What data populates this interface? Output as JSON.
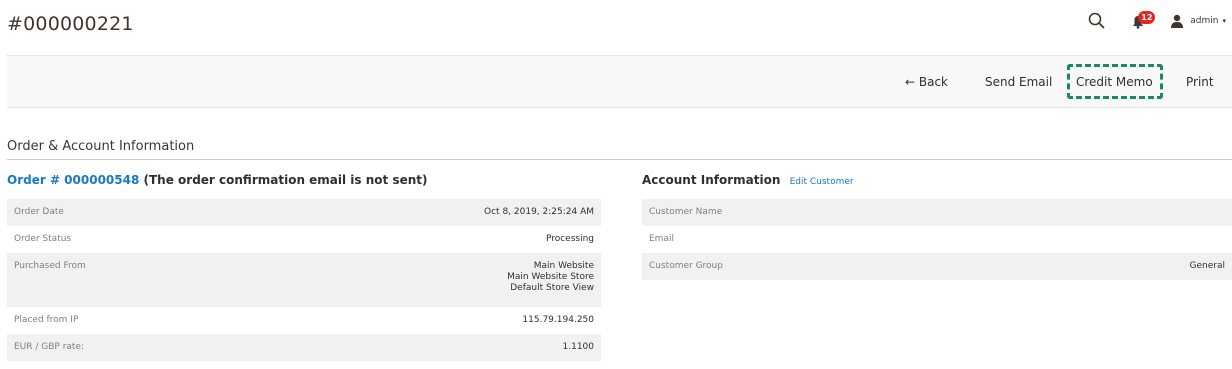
{
  "header": {
    "title": "#000000221",
    "notification_count": "12",
    "user_name": "admin",
    "caret": "▾"
  },
  "toolbar": {
    "back_label": "← Back",
    "send_email_label": "Send Email",
    "credit_memo_label": "Credit Memo",
    "print_label": "Print"
  },
  "section": {
    "title": "Order & Account Information"
  },
  "order": {
    "link_text": "Order # 000000548",
    "note": "(The order confirmation email is not sent)",
    "rows": [
      {
        "label": "Order Date",
        "value": "Oct 8, 2019, 2:25:24 AM"
      },
      {
        "label": "Order Status",
        "value": "Processing"
      },
      {
        "label": "Purchased From",
        "values": [
          "Main Website",
          "Main Website Store",
          "Default Store View"
        ]
      },
      {
        "label": "Placed from IP",
        "value": "115.79.194.250"
      },
      {
        "label": "EUR / GBP rate:",
        "value": "1.1100"
      }
    ]
  },
  "account": {
    "title": "Account Information",
    "edit_link": "Edit Customer",
    "rows": [
      {
        "label": "Customer Name",
        "value": ""
      },
      {
        "label": "Email",
        "value": ""
      },
      {
        "label": "Customer Group",
        "value": "General"
      }
    ]
  },
  "colors": {
    "link": "#1979c3",
    "badge": "#e22626",
    "highlight": "#1a8a5a"
  },
  "icons": {
    "search": "search-icon",
    "notifications": "bell-icon",
    "user": "user-icon"
  }
}
